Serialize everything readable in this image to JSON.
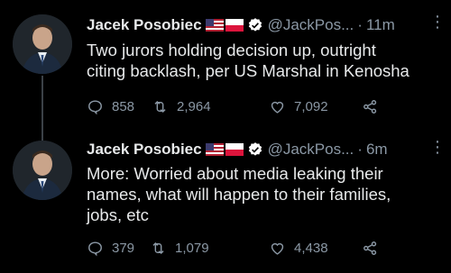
{
  "tweets": [
    {
      "author_name": "Jacek Posobiec",
      "handle": "@JackPos...",
      "separator": "·",
      "time": "11m",
      "text_lines": [
        "Two jurors holding decision up, outright",
        "citing backlash, per US Marshal in Kenosha"
      ],
      "replies": "858",
      "retweets": "2,964",
      "likes": "7,092",
      "icons": [
        "us-flag-icon",
        "poland-flag-icon",
        "verified-badge-icon",
        "more-icon",
        "reply-icon",
        "retweet-icon",
        "like-icon",
        "share-icon"
      ]
    },
    {
      "author_name": "Jacek Posobiec",
      "handle": "@JackPos...",
      "separator": "·",
      "time": "6m",
      "text_lines": [
        "More: Worried about media leaking their",
        "names, what will happen to their families,",
        "jobs, etc"
      ],
      "replies": "379",
      "retweets": "1,079",
      "likes": "4,438",
      "icons": [
        "us-flag-icon",
        "poland-flag-icon",
        "verified-badge-icon",
        "more-icon",
        "reply-icon",
        "retweet-icon",
        "like-icon",
        "share-icon"
      ]
    }
  ],
  "colors": {
    "background": "#000000",
    "text": "#e7e9ea",
    "secondary": "#8b98a5",
    "verified": "#ffffff"
  }
}
